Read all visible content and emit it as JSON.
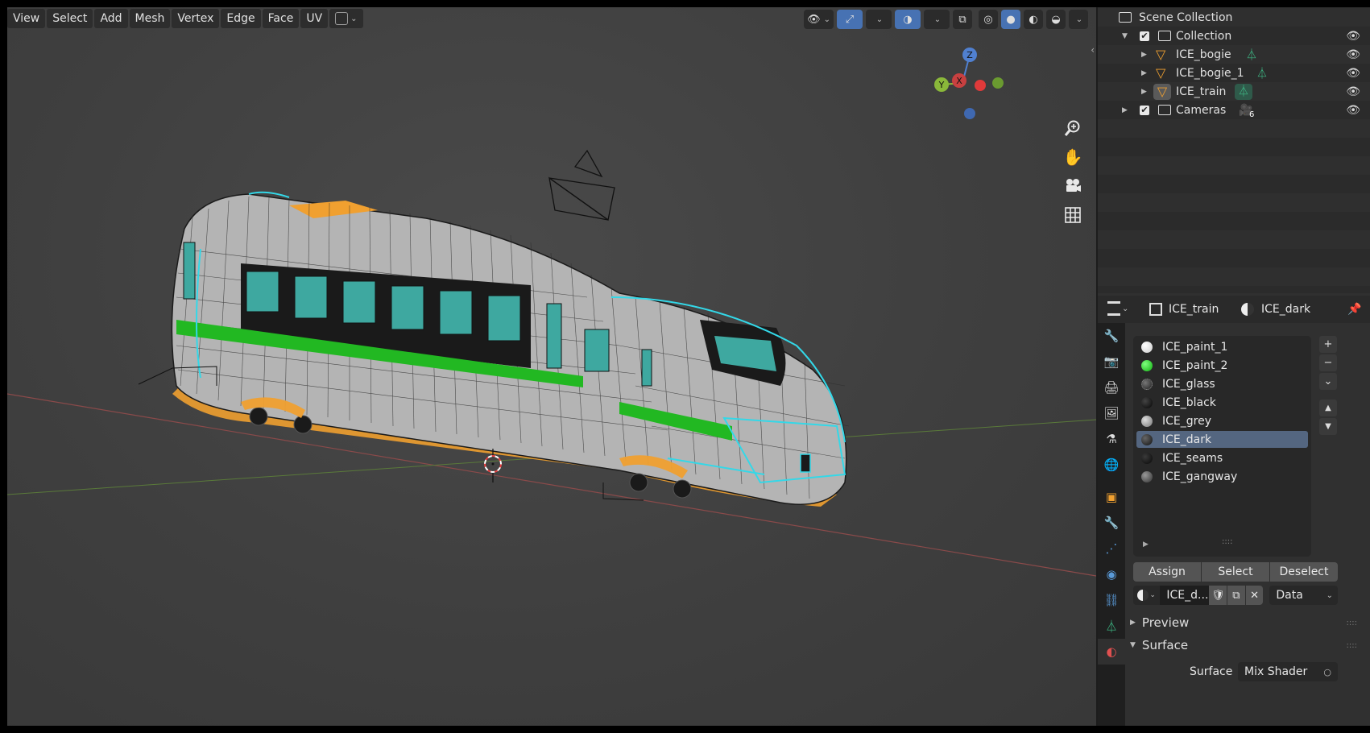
{
  "menu": [
    "View",
    "Select",
    "Add",
    "Mesh",
    "Vertex",
    "Edge",
    "Face",
    "UV"
  ],
  "gizmo": {
    "z": "Z",
    "y": "Y",
    "x": "X"
  },
  "outliner": {
    "scene_collection": "Scene Collection",
    "items": [
      {
        "label": "Collection",
        "type": "collection"
      },
      {
        "label": "ICE_bogie",
        "type": "object"
      },
      {
        "label": "ICE_bogie_1",
        "type": "object"
      },
      {
        "label": "ICE_train",
        "type": "object"
      },
      {
        "label": "Cameras",
        "type": "collection",
        "badge": "6"
      }
    ]
  },
  "properties": {
    "object_name": "ICE_train",
    "material_name": "ICE_dark",
    "materials": [
      {
        "name": "ICE_paint_1",
        "color": "#f2f2f2"
      },
      {
        "name": "ICE_paint_2",
        "color": "#1fd21f"
      },
      {
        "name": "ICE_glass",
        "color": "#3a3a3a"
      },
      {
        "name": "ICE_black",
        "color": "#111111"
      },
      {
        "name": "ICE_grey",
        "color": "#9a9a9a"
      },
      {
        "name": "ICE_dark",
        "color": "#2a2a2a"
      },
      {
        "name": "ICE_seams",
        "color": "#1a1a1a"
      },
      {
        "name": "ICE_gangway",
        "color": "#5a5a5a"
      }
    ],
    "selected_index": 5,
    "buttons": {
      "assign": "Assign",
      "select": "Select",
      "deselect": "Deselect"
    },
    "slot_material": "ICE_d...",
    "link": "Data",
    "sections": {
      "preview": "Preview",
      "surface": "Surface"
    },
    "surface_label": "Surface",
    "surface_value": "Mix Shader"
  },
  "colors": {
    "accent": "#4772b3",
    "selection": "#546680",
    "wire_orange": "#f0a030",
    "wire_cyan": "#33d8e8"
  }
}
